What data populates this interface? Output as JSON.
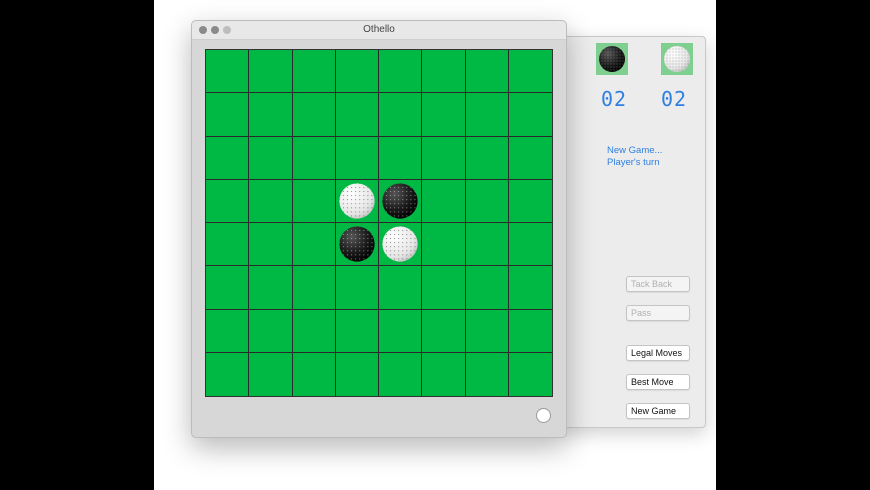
{
  "window": {
    "title": "Othello"
  },
  "scores": {
    "black": "02",
    "white": "02"
  },
  "status": {
    "line1": "New Game...",
    "line2": "Player's turn"
  },
  "buttons": {
    "take_back": "Tack Back",
    "pass": "Pass",
    "legal_moves": "Legal Moves",
    "best_move": "Best Move",
    "new_game": "New Game"
  },
  "board": {
    "size": 8,
    "pieces": [
      {
        "row": 3,
        "col": 3,
        "color": "white"
      },
      {
        "row": 3,
        "col": 4,
        "color": "black"
      },
      {
        "row": 4,
        "col": 3,
        "color": "black"
      },
      {
        "row": 4,
        "col": 4,
        "color": "white"
      }
    ],
    "turn": "white"
  },
  "colors": {
    "board_green": "#00b844",
    "score_blue": "#2f7fe0",
    "icon_bg": "#7fcf90"
  },
  "icons": {
    "black_piece": "black-disc-icon",
    "white_piece": "white-disc-icon"
  }
}
